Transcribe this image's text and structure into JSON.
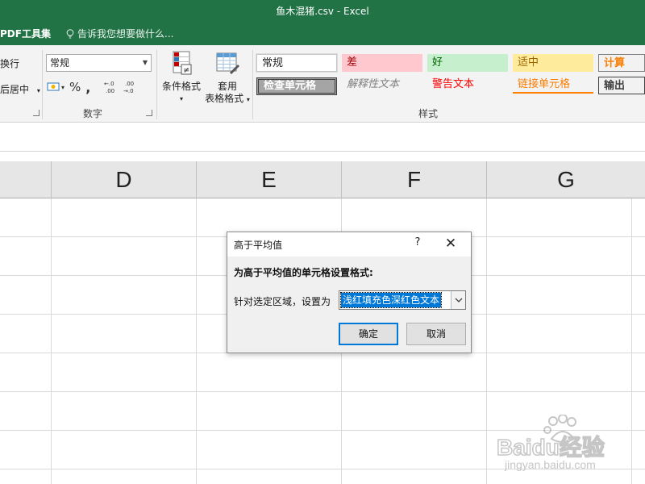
{
  "window": {
    "title": "鱼木混猪.csv - Excel"
  },
  "ribbon_tabs": {
    "pdf_tools": "PDF工具集",
    "tell_me": "告诉我您想要做什么..."
  },
  "ribbon": {
    "alignment": {
      "wrap_text": "换行",
      "merge_center": "后居中"
    },
    "number": {
      "format_value": "常规",
      "currency_symbol": "￥",
      "percent_symbol": "%",
      "comma_symbol": ",",
      "increase_decimal": "←.0 .00",
      "decrease_decimal": ".00 →.0",
      "group_label": "数字"
    },
    "conditional_formatting": {
      "label": "条件格式"
    },
    "format_as_table": {
      "label_line1": "套用",
      "label_line2": "表格格式"
    },
    "styles": {
      "group_label": "样式",
      "cells": [
        {
          "label": "常规"
        },
        {
          "label": "差"
        },
        {
          "label": "好"
        },
        {
          "label": "适中"
        },
        {
          "label": "计算"
        },
        {
          "label": "检查单元格"
        },
        {
          "label": "解释性文本"
        },
        {
          "label": "警告文本"
        },
        {
          "label": "链接单元格"
        },
        {
          "label": "输出"
        }
      ]
    }
  },
  "grid": {
    "columns": [
      "D",
      "E",
      "F",
      "G"
    ]
  },
  "dialog": {
    "title": "高于平均值",
    "help_glyph": "?",
    "close_glyph": "✕",
    "heading": "为高于平均值的单元格设置格式:",
    "range_label": "针对选定区域，设置为",
    "format_value": "浅红填充色深红色文本",
    "ok_label": "确定",
    "cancel_label": "取消"
  },
  "watermark": {
    "brand": "Baidu经验",
    "url": "jingyan.baidu.com"
  },
  "colors": {
    "excel_green": "#217346",
    "selection_blue": "#0078d7"
  }
}
